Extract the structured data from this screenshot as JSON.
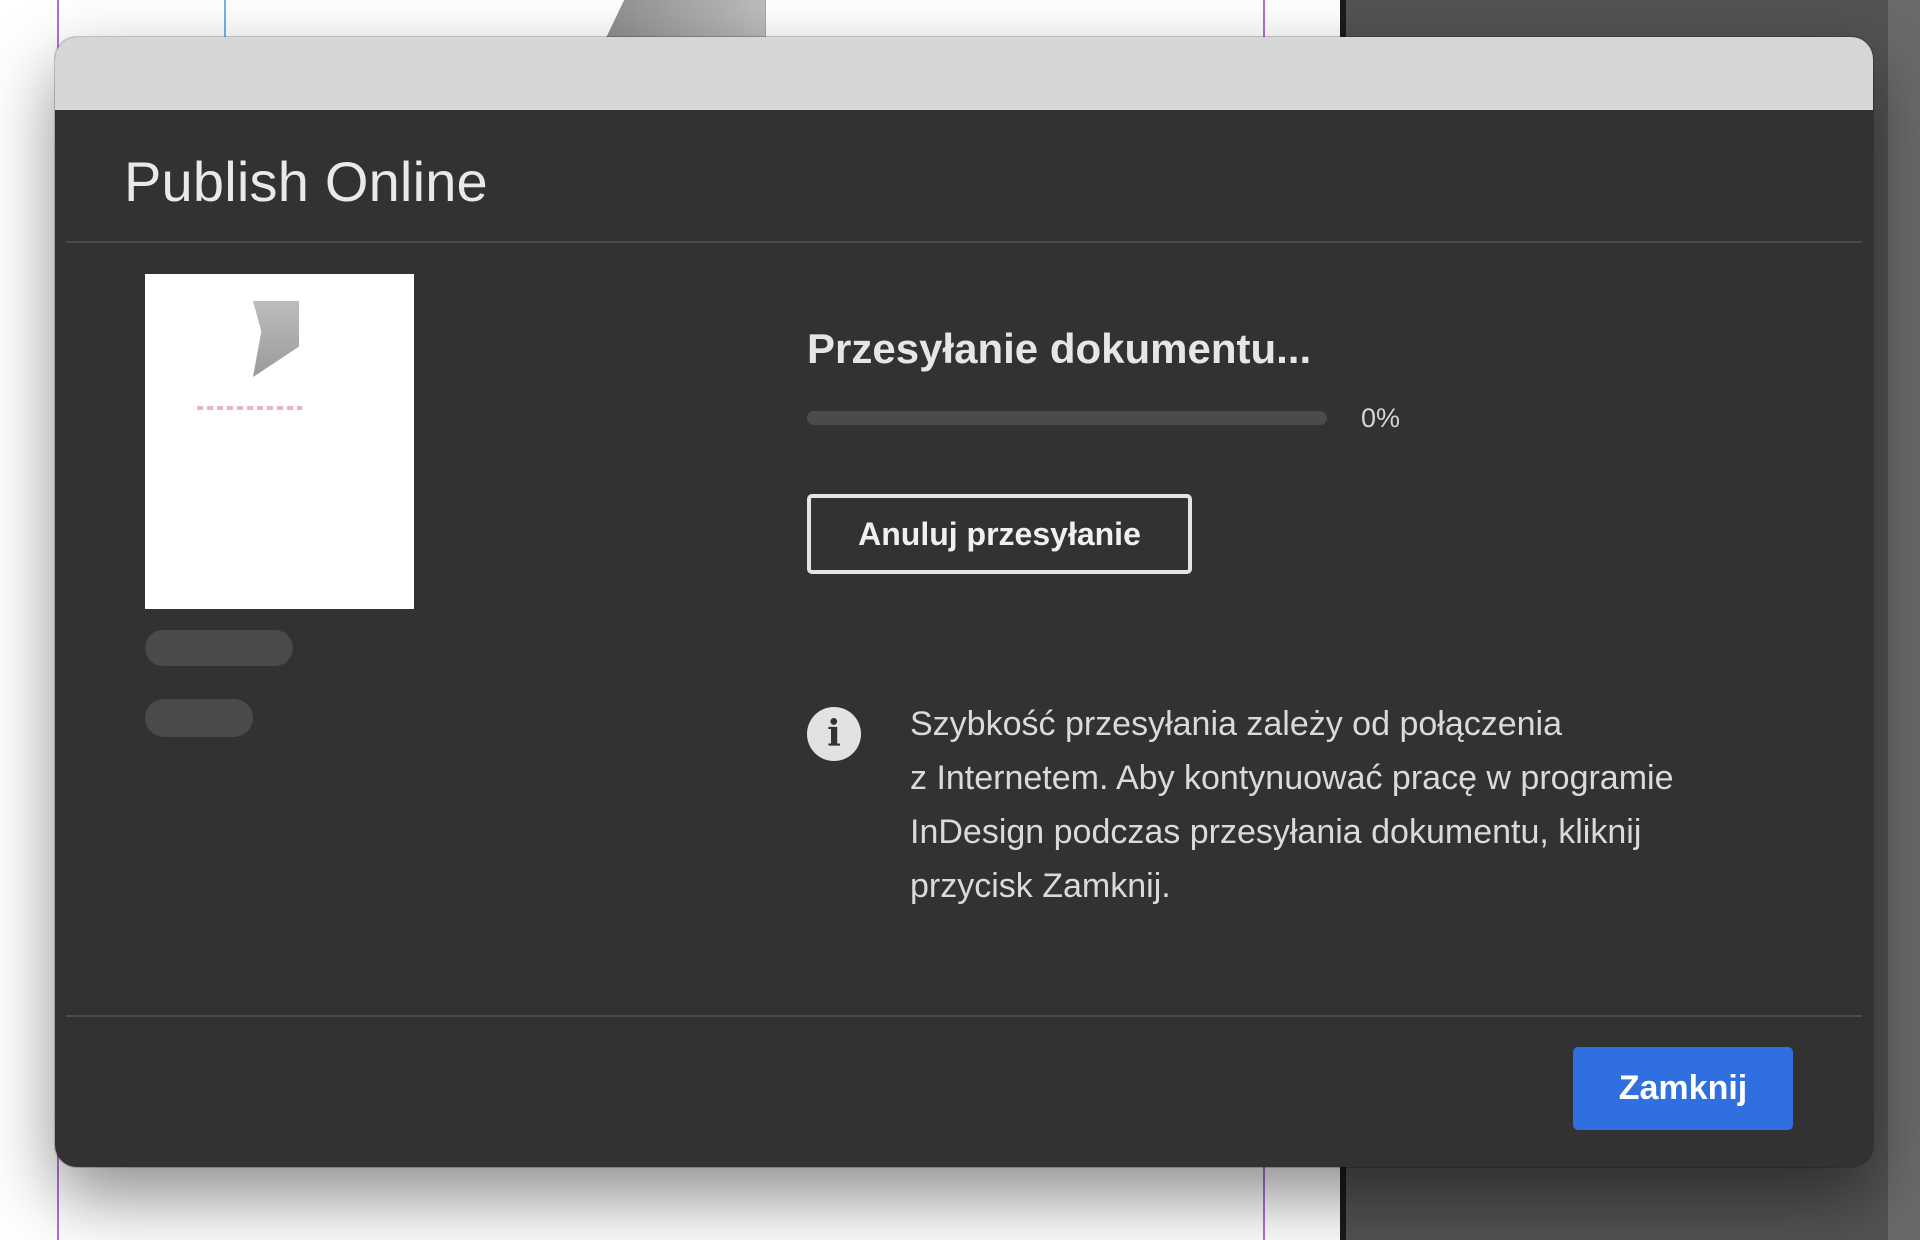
{
  "dialog": {
    "title": "Publish Online",
    "status_heading": "Przesyłanie dokumentu...",
    "progress_percent": 0,
    "progress_label": "0%",
    "cancel_label": "Anuluj przesyłanie",
    "info_lines": [
      "Szybkość przesyłania zależy od połączenia",
      "z Internetem. Aby kontynuować pracę w programie",
      "InDesign podczas przesyłania dokumentu, kliknij",
      "przycisk Zamknij."
    ],
    "info_icon": "info-icon",
    "close_label": "Zamknij"
  },
  "colors": {
    "dialog_bg": "#323232",
    "titlebar": "#d6d6d6",
    "accent": "#2f6fe0",
    "guide": "#b36fd6",
    "pasteboard": "#535353"
  }
}
